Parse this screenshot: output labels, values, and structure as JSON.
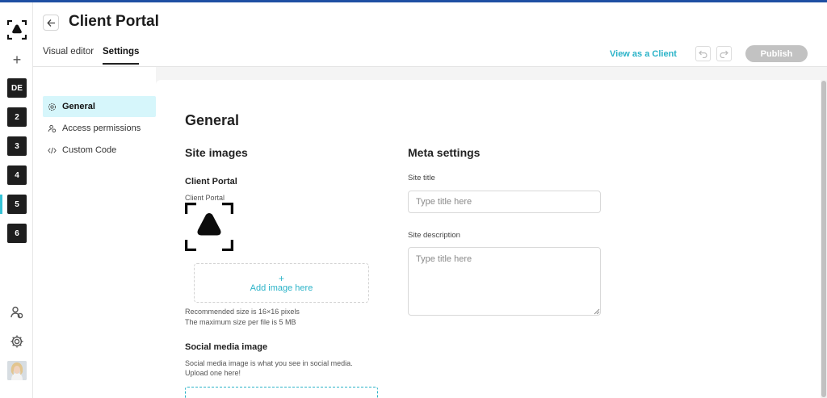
{
  "header": {
    "title": "Client Portal",
    "tabs": [
      {
        "label": "Visual editor",
        "active": false
      },
      {
        "label": "Settings",
        "active": true
      }
    ],
    "view_as_client": "View as a Client",
    "publish_label": "Publish"
  },
  "rail": {
    "workspaces": [
      "DE",
      "2",
      "3",
      "4",
      "5",
      "6"
    ],
    "active_workspace": "5"
  },
  "settings_nav": {
    "items": [
      {
        "label": "General",
        "icon": "gear-icon",
        "active": true
      },
      {
        "label": "Access permissions",
        "icon": "users-icon",
        "active": false
      },
      {
        "label": "Custom Code",
        "icon": "code-icon",
        "active": false
      }
    ]
  },
  "general": {
    "heading": "General",
    "site_images": {
      "heading": "Site images",
      "portal_logo_title": "Client Portal",
      "portal_logo_caption": "Client Portal",
      "add_image_plus": "+",
      "add_image_label": "Add image here",
      "recommended": "Recommended size is 16×16 pixels",
      "max_size": "The maximum size per file is 5 MB",
      "social_title": "Social media image",
      "social_desc_1": "Social media image is what you see in social media.",
      "social_desc_2": "Upload one here!"
    },
    "meta": {
      "heading": "Meta settings",
      "site_title_label": "Site title",
      "site_title_placeholder": "Type title here",
      "site_description_label": "Site description",
      "site_description_placeholder": "Type title here"
    }
  },
  "colors": {
    "accent": "#2bb3c8",
    "active_nav_bg": "#d6f6fb",
    "top_stripe": "#1e4fa3",
    "publish_disabled": "#c2c2c2"
  }
}
